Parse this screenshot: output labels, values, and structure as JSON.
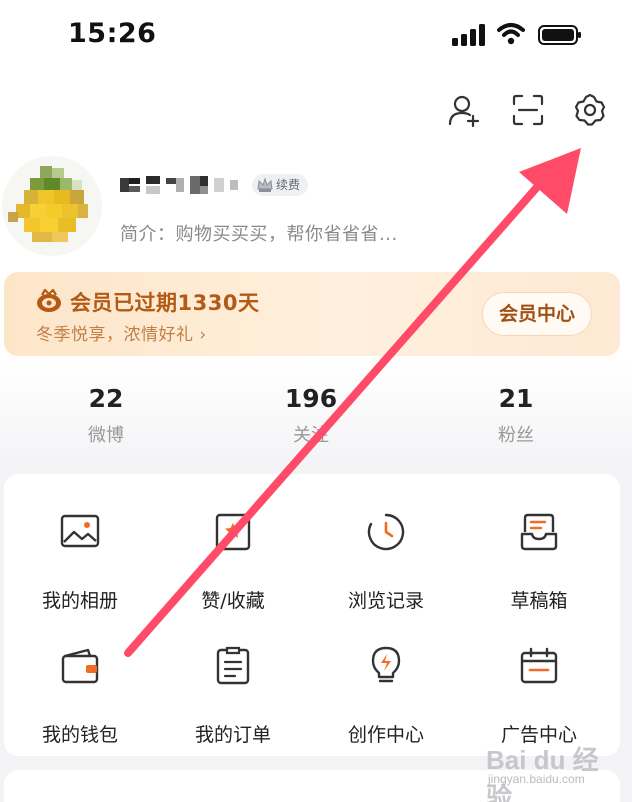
{
  "status_bar": {
    "time": "15:26"
  },
  "profile": {
    "renew_badge": "续费",
    "bio": "简介：购物买买买，帮你省省省..."
  },
  "vip": {
    "title": "会员已过期1330天",
    "subtitle": "冬季悦享，浓情好礼 ›",
    "button": "会员中心"
  },
  "stats": [
    {
      "value": "22",
      "label": "微博"
    },
    {
      "value": "196",
      "label": "关注"
    },
    {
      "value": "21",
      "label": "粉丝"
    }
  ],
  "grid": [
    {
      "label": "我的相册",
      "icon": "album-icon"
    },
    {
      "label": "赞/收藏",
      "icon": "favorites-icon"
    },
    {
      "label": "浏览记录",
      "icon": "history-icon"
    },
    {
      "label": "草稿箱",
      "icon": "drafts-icon"
    },
    {
      "label": "我的钱包",
      "icon": "wallet-icon"
    },
    {
      "label": "我的订单",
      "icon": "orders-icon"
    },
    {
      "label": "创作中心",
      "icon": "creator-icon"
    },
    {
      "label": "广告中心",
      "icon": "ads-icon"
    }
  ],
  "watermark": {
    "text": "Bai du 经验",
    "url": "jingyan.baidu.com"
  },
  "colors": {
    "accent": "#ff4a68",
    "vip_text": "#b25a16",
    "icon_orange": "#f26a23"
  }
}
